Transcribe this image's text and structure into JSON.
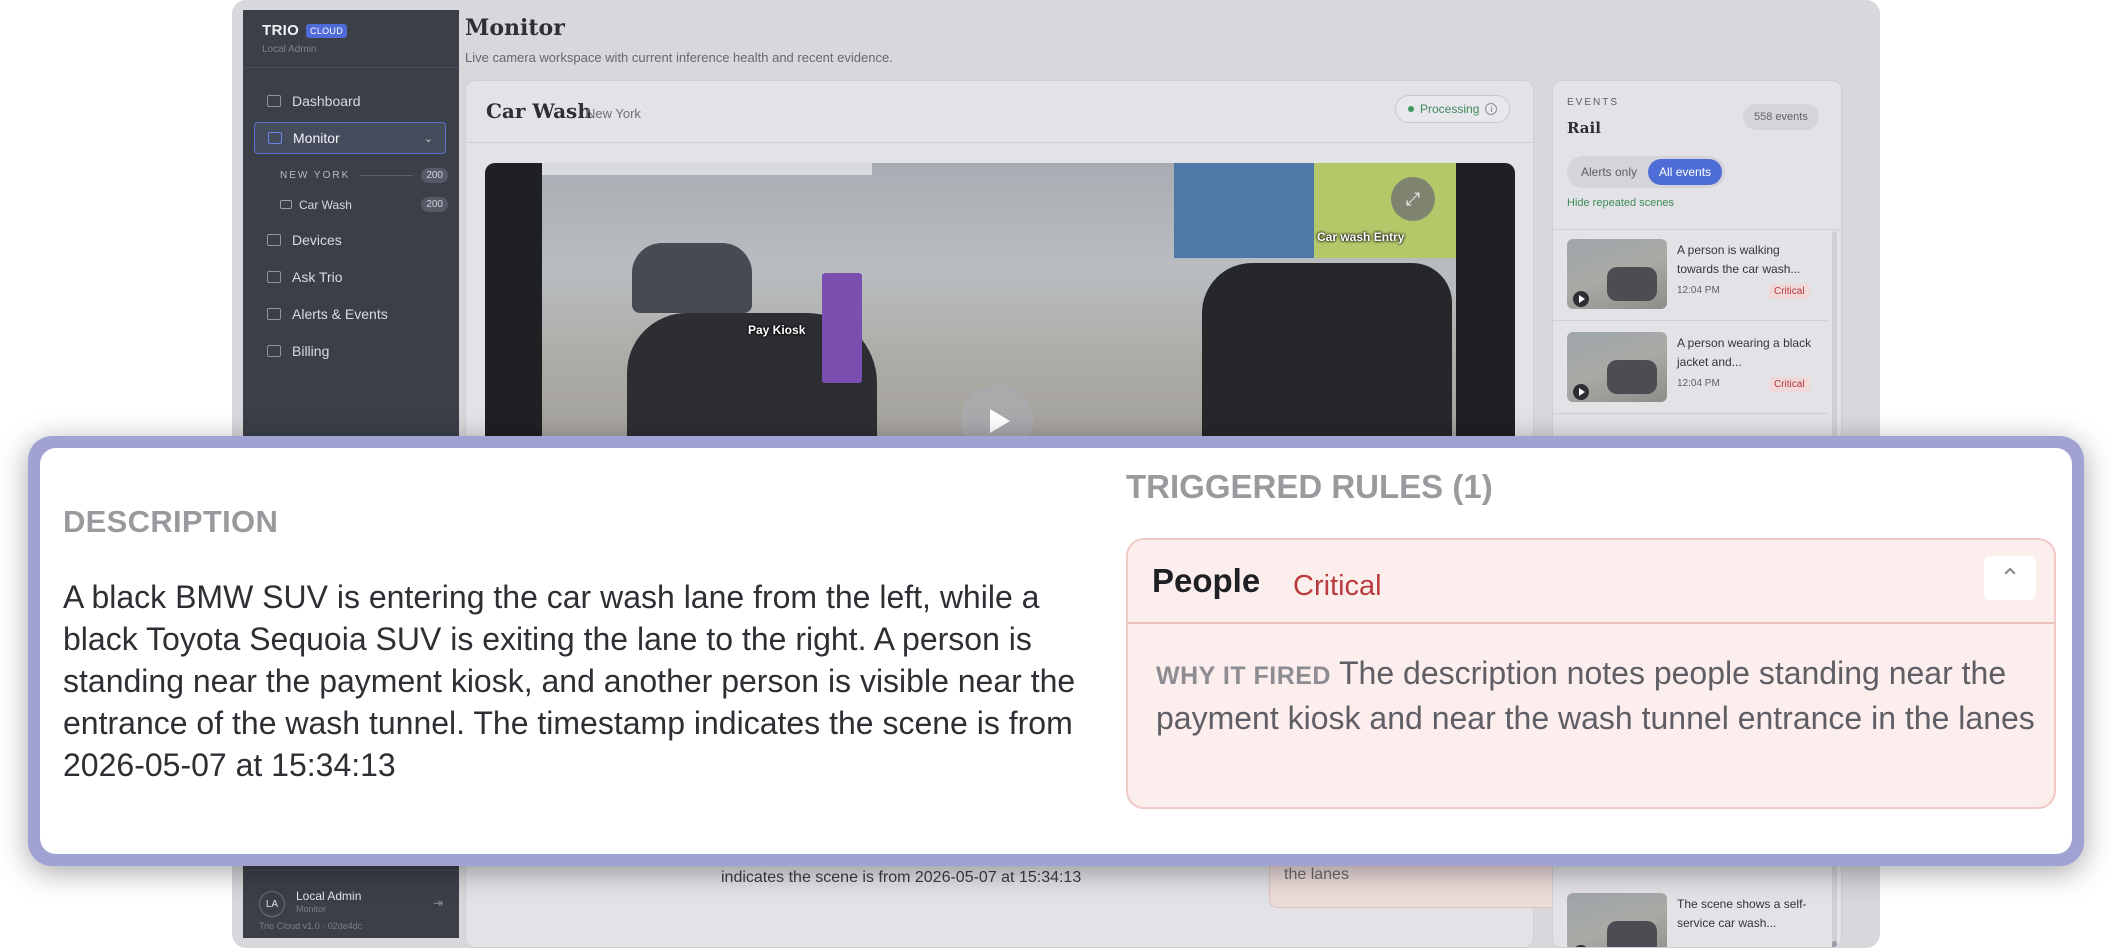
{
  "brand": {
    "name": "TRIO",
    "badge": "CLOUD",
    "subtitle": "Local Admin"
  },
  "nav": {
    "items": [
      {
        "label": "Dashboard",
        "icon": "grid-icon"
      },
      {
        "label": "Monitor",
        "icon": "camera-icon",
        "active": true
      }
    ],
    "group": {
      "label": "NEW YORK",
      "count": "200"
    },
    "camera": {
      "label": "Car Wash",
      "count": "200"
    },
    "items2": [
      {
        "label": "Devices",
        "icon": "devices-icon"
      },
      {
        "label": "Ask Trio",
        "icon": "chat-icon"
      },
      {
        "label": "Alerts & Events",
        "icon": "bell-icon"
      },
      {
        "label": "Billing",
        "icon": "card-icon"
      }
    ]
  },
  "user": {
    "initials": "LA",
    "name": "Local Admin",
    "role": "Monitor",
    "version": "Trio Cloud v1.0 · 02de4dc"
  },
  "page": {
    "title": "Monitor",
    "subtitle": "Live camera workspace with current inference health and recent evidence."
  },
  "camera_card": {
    "title": "Car Wash",
    "location": "New York",
    "status": "Processing",
    "video_labels": {
      "kiosk": "Pay Kiosk",
      "entry": "Car wash Entry"
    }
  },
  "background_below": {
    "desc_tail": "indicates the scene is from 2026-05-07 at 15:34:13",
    "rule_tail": "the lanes"
  },
  "rail": {
    "kicker": "EVENTS",
    "title": "Rail",
    "count": "558 events",
    "filter_alerts": "Alerts only",
    "filter_all": "All events",
    "hide_repeated": "Hide repeated scenes",
    "events": [
      {
        "text": "A person is walking towards the car wash...",
        "time": "12:04 PM",
        "severity": "Critical"
      },
      {
        "text": "A person wearing a black jacket and...",
        "time": "12:04 PM",
        "severity": "Critical"
      }
    ],
    "last_event": {
      "text": "The scene shows a self-service car wash..."
    }
  },
  "zoom": {
    "description_heading": "DESCRIPTION",
    "description": "A black BMW SUV is entering the car wash lane from the left, while a black Toyota Sequoia SUV is exiting the lane to the right. A person is standing near the payment kiosk, and another person is visible near the entrance of the wash tunnel. The timestamp indicates the scene is from 2026-05-07 at 15:34:13",
    "rules_heading": "TRIGGERED RULES (1)",
    "rule": {
      "name": "People",
      "severity": "Critical",
      "why_label": "WHY IT FIRED",
      "why_text": "The description notes people standing near the payment kiosk and near the wash tunnel entrance in the lanes"
    }
  },
  "colors": {
    "accent": "#4e6dd6",
    "critical": "#b93c3f",
    "processing": "#3e8a5c",
    "zoom_border": "#9fa2d3"
  }
}
